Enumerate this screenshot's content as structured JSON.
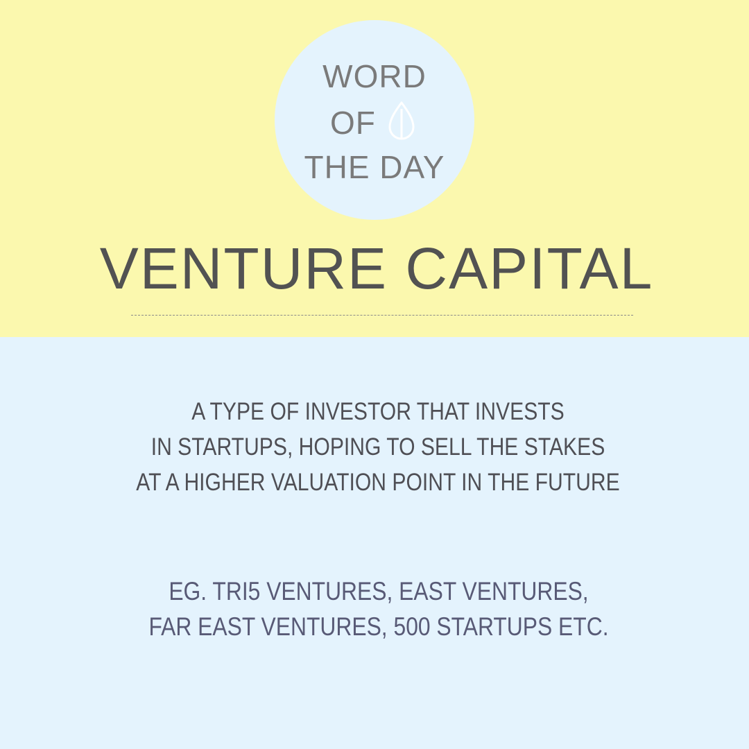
{
  "colors": {
    "top_background": "#fbf8ae",
    "bottom_background": "#e4f3fd",
    "badge_background": "#e4f3fd",
    "badge_text": "#7a7a7a",
    "title_text": "#525252",
    "definition_text": "#4f4f55",
    "examples_text": "#585a76",
    "icon_stroke": "#ffffff"
  },
  "badge": {
    "line1": "WORD",
    "line2": "OF",
    "line3": "THE DAY",
    "icon": "drop-icon"
  },
  "term": {
    "title": "VENTURE CAPITAL"
  },
  "definition": {
    "lines": [
      "A TYPE OF INVESTOR THAT INVESTS",
      "IN STARTUPS, HOPING TO SELL THE STAKES",
      "AT A HIGHER VALUATION POINT IN THE FUTURE"
    ]
  },
  "examples": {
    "lines": [
      "EG. TRI5 VENTURES, EAST VENTURES,",
      "FAR EAST VENTURES, 500 STARTUPS ETC."
    ]
  }
}
